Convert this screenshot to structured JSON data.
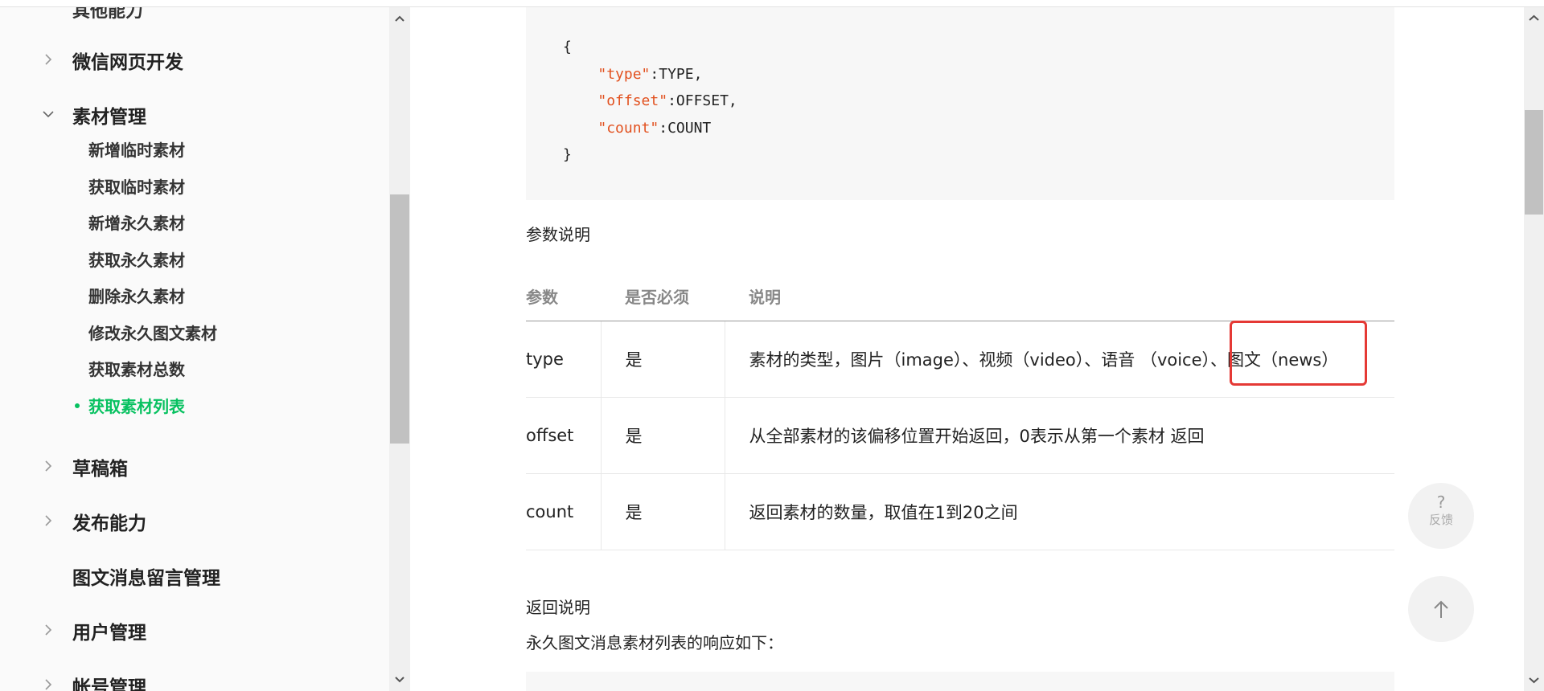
{
  "sidebar": {
    "clipped_top": "其他能力",
    "groups": [
      {
        "label": "微信网页开发",
        "expanded": false
      },
      {
        "label": "素材管理",
        "expanded": true
      },
      {
        "label": "草稿箱",
        "expanded": false
      },
      {
        "label": "发布能力",
        "expanded": false
      },
      {
        "label": "图文消息留言管理",
        "expanded": false
      },
      {
        "label": "用户管理",
        "expanded": false
      },
      {
        "label": "帐号管理",
        "expanded": false
      }
    ],
    "material_items": [
      "新增临时素材",
      "获取临时素材",
      "新增永久素材",
      "获取永久素材",
      "删除永久素材",
      "修改永久图文素材",
      "获取素材总数",
      "获取素材列表"
    ],
    "active_item": "获取素材列表"
  },
  "code": {
    "open": "{",
    "lines": [
      {
        "key": "\"type\"",
        "value": "TYPE,"
      },
      {
        "key": "\"offset\"",
        "value": "OFFSET,"
      },
      {
        "key": "\"count\"",
        "value": "COUNT"
      }
    ],
    "close": "}"
  },
  "params_title": "参数说明",
  "param_table": {
    "headers": [
      "参数",
      "是否必须",
      "说明"
    ],
    "rows": [
      {
        "name": "type",
        "required": "是",
        "desc": "素材的类型，图片（image）、视频（video）、语音 （voice）、图文（news）"
      },
      {
        "name": "offset",
        "required": "是",
        "desc": "从全部素材的该偏移位置开始返回，0表示从第一个素材 返回"
      },
      {
        "name": "count",
        "required": "是",
        "desc": "返回素材的数量，取值在1到20之间"
      }
    ]
  },
  "return_title": "返回说明",
  "return_desc": "永久图文消息素材列表的响应如下：",
  "float": {
    "feedback_symbol": "?",
    "feedback_label": "反馈"
  },
  "colors": {
    "accent": "#07c160",
    "code_key": "#e2511f",
    "highlight": "#e53935"
  }
}
